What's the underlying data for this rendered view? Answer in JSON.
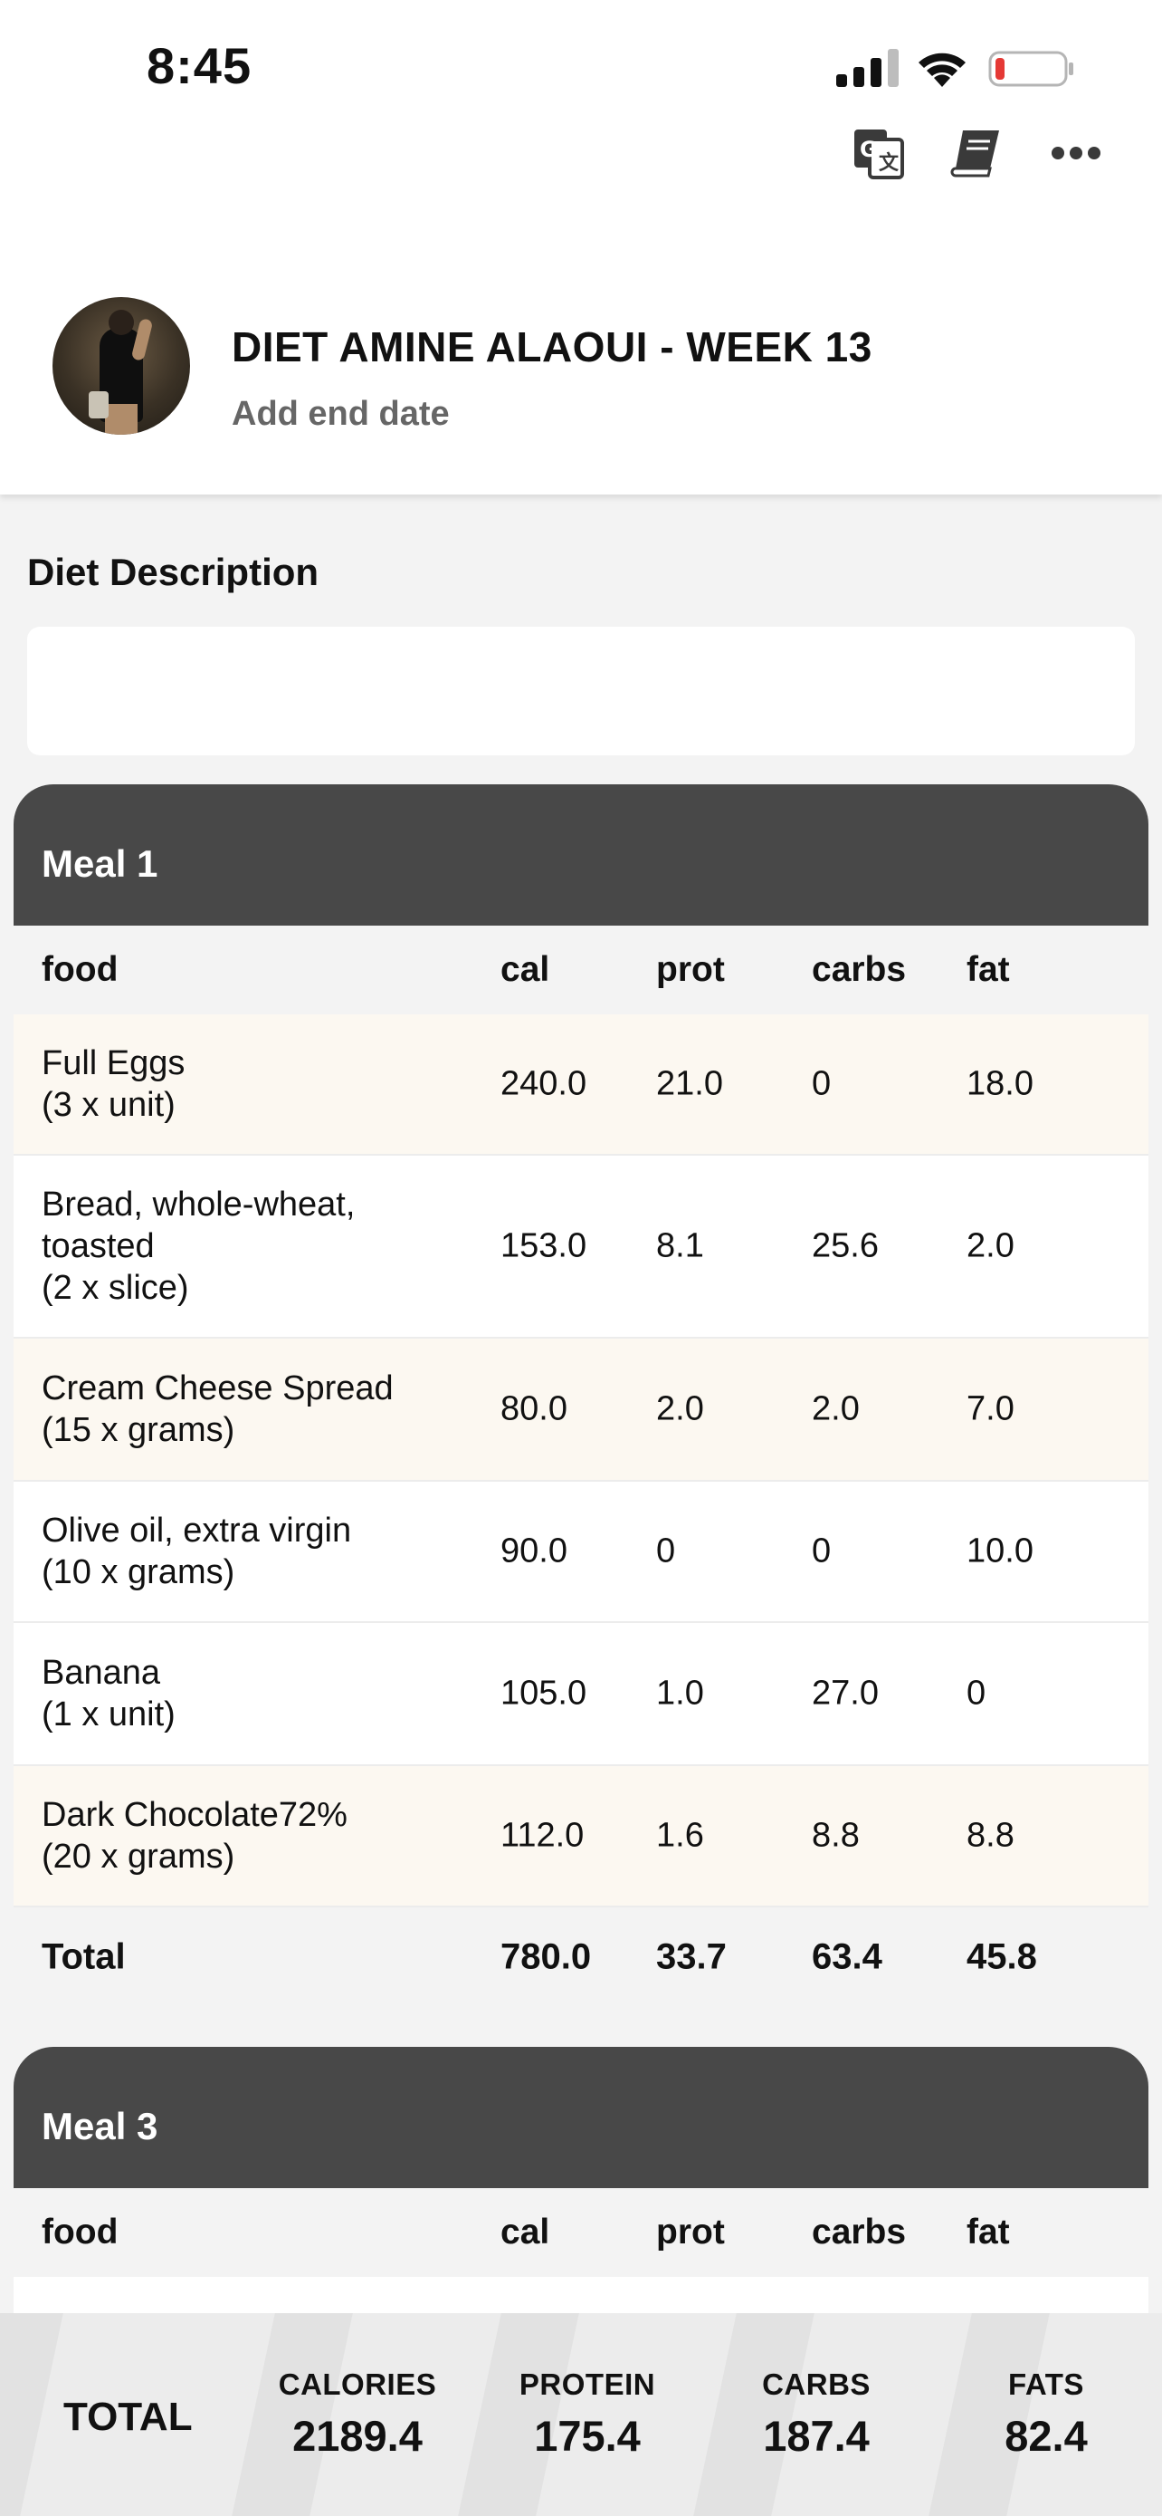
{
  "status_bar": {
    "time": "8:45"
  },
  "header": {
    "title": "DIET AMINE ALAOUI - WEEK 13",
    "subtitle": "Add end date",
    "icons": [
      "translate-icon",
      "book-icon",
      "more-icon"
    ]
  },
  "description": {
    "label": "Diet Description",
    "value": ""
  },
  "columns": {
    "food": "food",
    "cal": "cal",
    "prot": "prot",
    "carbs": "carbs",
    "fat": "fat"
  },
  "meals": [
    {
      "title": "Meal 1",
      "rows": [
        {
          "name": "Full Eggs",
          "qty": "(3 x unit)",
          "cal": "240.0",
          "prot": "21.0",
          "carbs": "0",
          "fat": "18.0"
        },
        {
          "name": "Bread, whole-wheat,",
          "name2": "toasted",
          "qty": "(2 x slice)",
          "cal": "153.0",
          "prot": "8.1",
          "carbs": "25.6",
          "fat": "2.0"
        },
        {
          "name": "Cream Cheese Spread",
          "qty": "(15 x grams)",
          "cal": "80.0",
          "prot": "2.0",
          "carbs": "2.0",
          "fat": "7.0"
        },
        {
          "name": "Olive oil, extra virgin",
          "qty": "(10 x grams)",
          "cal": "90.0",
          "prot": "0",
          "carbs": "0",
          "fat": "10.0"
        },
        {
          "name": "Banana",
          "qty": "(1 x unit)",
          "cal": "105.0",
          "prot": "1.0",
          "carbs": "27.0",
          "fat": "0"
        },
        {
          "name": "Dark Chocolate72%",
          "qty": "(20 x grams)",
          "cal": "112.0",
          "prot": "1.6",
          "carbs": "8.8",
          "fat": "8.8"
        }
      ],
      "total": {
        "label": "Total",
        "cal": "780.0",
        "prot": "33.7",
        "carbs": "63.4",
        "fat": "45.8"
      }
    },
    {
      "title": "Meal 3"
    }
  ],
  "totals_bar": {
    "label": "TOTAL",
    "calories_label": "CALORIES",
    "calories": "2189.4",
    "protein_label": "PROTEIN",
    "protein": "175.4",
    "carbs_label": "CARBS",
    "carbs": "187.4",
    "fats_label": "FATS",
    "fats": "82.4"
  },
  "colors": {
    "meal_header": "#484848",
    "row_alt": "#fcf8f1",
    "battery_low": "#e53935"
  }
}
